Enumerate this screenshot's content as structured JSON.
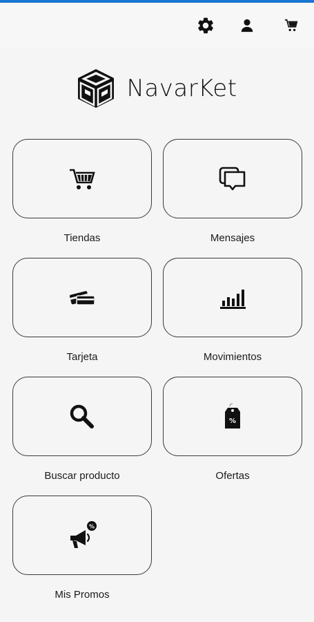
{
  "app": {
    "name": "NavarKet"
  },
  "colors": {
    "accent": "#1976d2",
    "background": "#f5f5f5",
    "icon": "#111111"
  },
  "topbar": {
    "icons": [
      "gear-icon",
      "user-icon",
      "cart-icon"
    ]
  },
  "menu": [
    {
      "label": "Tiendas",
      "icon": "shopping-cart-icon"
    },
    {
      "label": "Mensajes",
      "icon": "chat-bubbles-icon"
    },
    {
      "label": "Tarjeta",
      "icon": "credit-cards-icon"
    },
    {
      "label": "Movimientos",
      "icon": "bar-chart-icon"
    },
    {
      "label": "Buscar producto",
      "icon": "search-icon"
    },
    {
      "label": "Ofertas",
      "icon": "price-tag-icon"
    },
    {
      "label": "Mis Promos",
      "icon": "megaphone-percent-icon"
    }
  ]
}
